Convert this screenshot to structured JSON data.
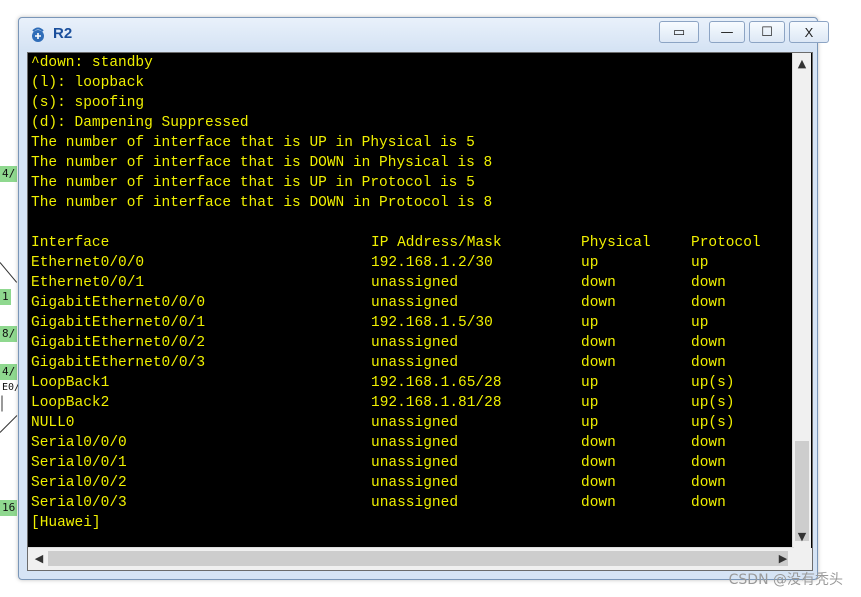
{
  "window": {
    "title": "R2",
    "buttons": {
      "restore": "▭",
      "minimize": "—",
      "maximize": "☐",
      "close": "X"
    }
  },
  "background": {
    "labels": [
      "4/",
      "1",
      "8/",
      "4/",
      "E0/",
      "16"
    ]
  },
  "terminal": {
    "header_lines": [
      "^down: standby",
      "(l): loopback",
      "(s): spoofing",
      "(d): Dampening Suppressed",
      "The number of interface that is UP in Physical is 5",
      "The number of interface that is DOWN in Physical is 8",
      "The number of interface that is UP in Protocol is 5",
      "The number of interface that is DOWN in Protocol is 8"
    ],
    "table_headers": [
      "Interface",
      "IP Address/Mask",
      "Physical",
      "Protocol"
    ],
    "rows": [
      [
        "Ethernet0/0/0",
        "192.168.1.2/30",
        "up",
        "up"
      ],
      [
        "Ethernet0/0/1",
        "unassigned",
        "down",
        "down"
      ],
      [
        "GigabitEthernet0/0/0",
        "unassigned",
        "down",
        "down"
      ],
      [
        "GigabitEthernet0/0/1",
        "192.168.1.5/30",
        "up",
        "up"
      ],
      [
        "GigabitEthernet0/0/2",
        "unassigned",
        "down",
        "down"
      ],
      [
        "GigabitEthernet0/0/3",
        "unassigned",
        "down",
        "down"
      ],
      [
        "LoopBack1",
        "192.168.1.65/28",
        "up",
        "up(s)"
      ],
      [
        "LoopBack2",
        "192.168.1.81/28",
        "up",
        "up(s)"
      ],
      [
        "NULL0",
        "unassigned",
        "up",
        "up(s)"
      ],
      [
        "Serial0/0/0",
        "unassigned",
        "down",
        "down"
      ],
      [
        "Serial0/0/1",
        "unassigned",
        "down",
        "down"
      ],
      [
        "Serial0/0/2",
        "unassigned",
        "down",
        "down"
      ],
      [
        "Serial0/0/3",
        "unassigned",
        "down",
        "down"
      ]
    ],
    "prompt": "[Huawei]"
  },
  "watermark": "CSDN @没有秃头",
  "colors": {
    "terminal_text": "#f0f000",
    "terminal_bg": "#000000",
    "title": "#1a4f9c"
  }
}
